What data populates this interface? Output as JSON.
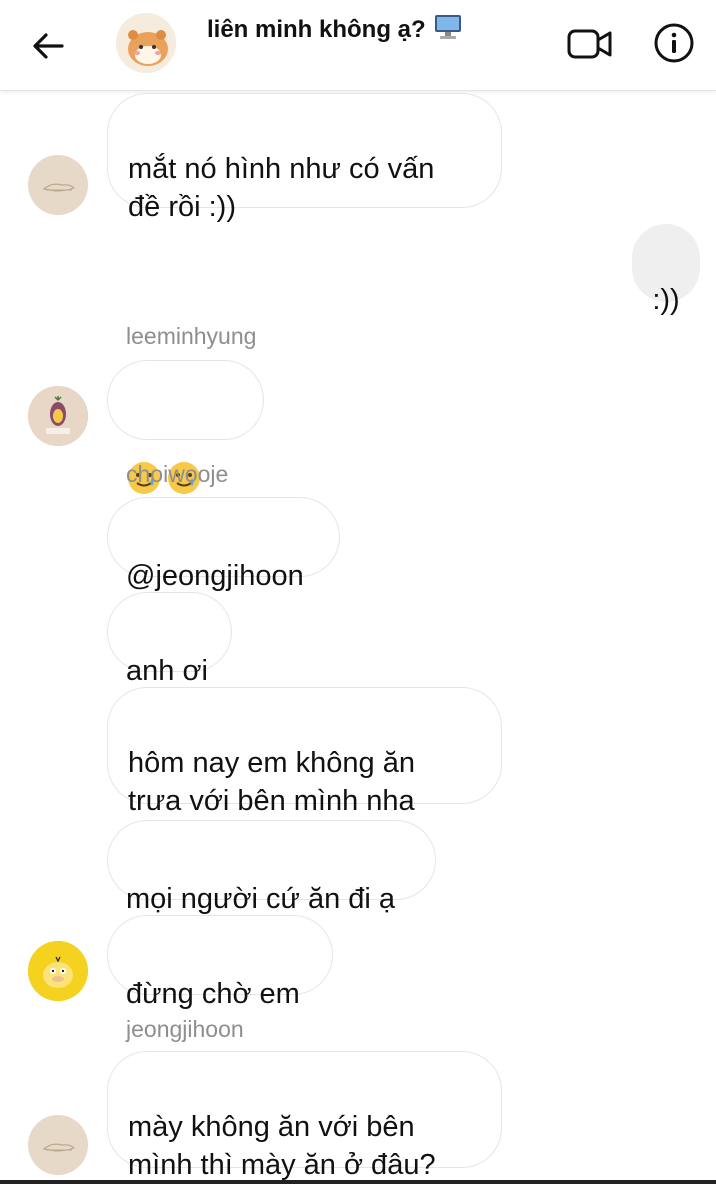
{
  "header": {
    "title": "liên minh không ạ?",
    "title_emoji": "desktop-computer-emoji",
    "icons": [
      "back-arrow-icon",
      "video-call-icon",
      "info-icon"
    ]
  },
  "messages": [
    {
      "text": "mắt nó hình như có vấn\nđề rồi :))",
      "from": "jeongjihoon",
      "mine": false
    },
    {
      "text": ":))",
      "mine": true
    },
    {
      "sender": "leeminhyung"
    },
    {
      "text": "🥲🥲🥲",
      "emoji": "smiling-face-with-tear",
      "count": 3
    },
    {
      "sender": "choiwooje"
    },
    {
      "text": "@jeongjihoon"
    },
    {
      "text": "anh ơi"
    },
    {
      "text": "hôm nay em không ăn\ntrưa với bên mình nha"
    },
    {
      "text": "mọi người cứ ăn đi ạ"
    },
    {
      "text": "đừng chờ em"
    },
    {
      "sender": "jeongjihoon"
    },
    {
      "text": "mày không ăn với bên\nmình thì mày ăn ở đâu?"
    }
  ],
  "colors": {
    "bubble_mine": "#efefef",
    "bubble_other_border": "#e5e5e5",
    "sender": "#8e8e8e"
  }
}
